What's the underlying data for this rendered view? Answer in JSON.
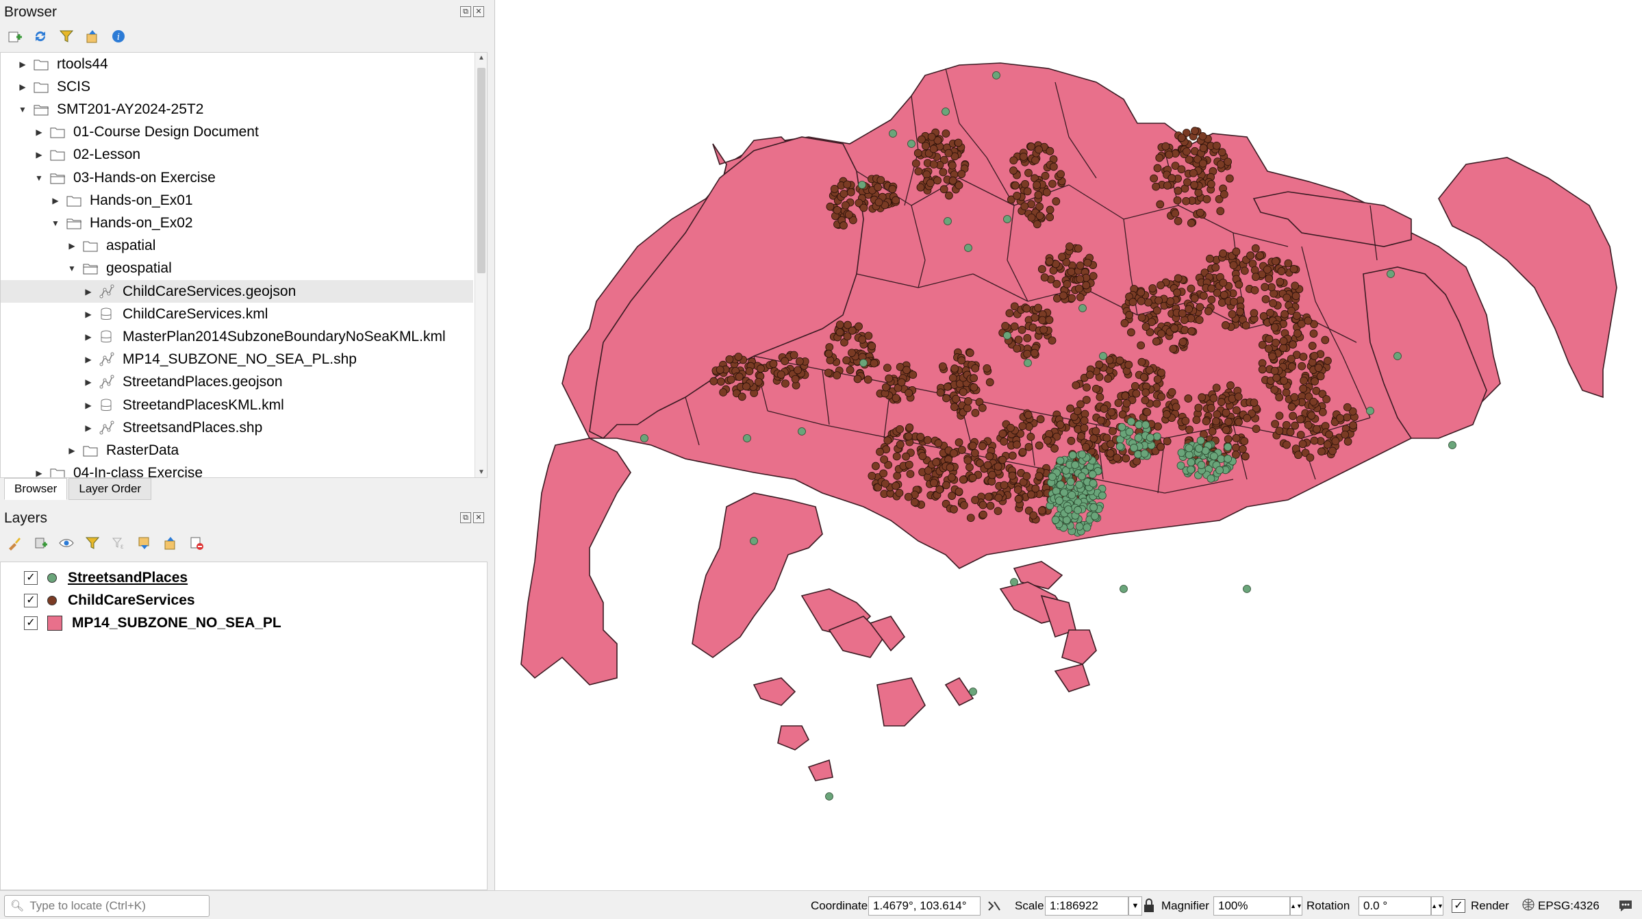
{
  "browser": {
    "title": "Browser",
    "tree": [
      {
        "label": "rtools44",
        "expanded": false,
        "icon": "folder-icon"
      },
      {
        "label": "SCIS",
        "expanded": false,
        "icon": "folder-icon"
      },
      {
        "label": "SMT201-AY2024-25T2",
        "expanded": true,
        "icon": "folder-open-icon"
      },
      {
        "label": "01-Course Design Document",
        "expanded": false,
        "icon": "folder-icon"
      },
      {
        "label": "02-Lesson",
        "expanded": false,
        "icon": "folder-icon"
      },
      {
        "label": "03-Hands-on Exercise",
        "expanded": true,
        "icon": "folder-open-icon"
      },
      {
        "label": "Hands-on_Ex01",
        "expanded": false,
        "icon": "folder-icon"
      },
      {
        "label": "Hands-on_Ex02",
        "expanded": true,
        "icon": "folder-open-icon"
      },
      {
        "label": "aspatial",
        "expanded": false,
        "icon": "folder-icon"
      },
      {
        "label": "geospatial",
        "expanded": true,
        "icon": "folder-open-icon"
      },
      {
        "label": "ChildCareServices.geojson",
        "expanded": false,
        "icon": "vector-icon",
        "selected": true
      },
      {
        "label": "ChildCareServices.kml",
        "expanded": false,
        "icon": "database-icon"
      },
      {
        "label": "MasterPlan2014SubzoneBoundaryNoSeaKML.kml",
        "expanded": false,
        "icon": "database-icon"
      },
      {
        "label": "MP14_SUBZONE_NO_SEA_PL.shp",
        "expanded": false,
        "icon": "vector-icon"
      },
      {
        "label": "StreetandPlaces.geojson",
        "expanded": false,
        "icon": "vector-icon"
      },
      {
        "label": "StreetandPlacesKML.kml",
        "expanded": false,
        "icon": "database-icon"
      },
      {
        "label": "StreetsandPlaces.shp",
        "expanded": false,
        "icon": "vector-icon"
      },
      {
        "label": "RasterData",
        "expanded": false,
        "icon": "folder-icon"
      },
      {
        "label": "04-In-class Exercise",
        "expanded": false,
        "icon": "folder-icon"
      }
    ],
    "tabs": [
      "Browser",
      "Layer Order"
    ]
  },
  "layers": {
    "title": "Layers",
    "items": [
      {
        "label": "StreetsandPlaces",
        "checked": true,
        "symbol": "point",
        "color": "#6aa57a",
        "underline": true
      },
      {
        "label": "ChildCareServices",
        "checked": true,
        "symbol": "point",
        "color": "#7a3b24",
        "underline": false
      },
      {
        "label": "MP14_SUBZONE_NO_SEA_PL",
        "checked": true,
        "symbol": "polygon",
        "color": "#e8708b",
        "underline": false
      }
    ]
  },
  "map": {
    "polygon_color": "#e8708b",
    "childcare_color": "#7a3b24",
    "streets_color": "#6aa57a"
  },
  "status": {
    "locate_placeholder": "Type to locate (Ctrl+K)",
    "coordinate_label": "Coordinate",
    "coordinate_value": "1.4679°, 103.614°",
    "scale_label": "Scale",
    "scale_value": "1:186922",
    "magnifier_label": "Magnifier",
    "magnifier_value": "100%",
    "rotation_label": "Rotation",
    "rotation_value": "0.0 °",
    "render_label": "Render",
    "crs": "EPSG:4326"
  }
}
